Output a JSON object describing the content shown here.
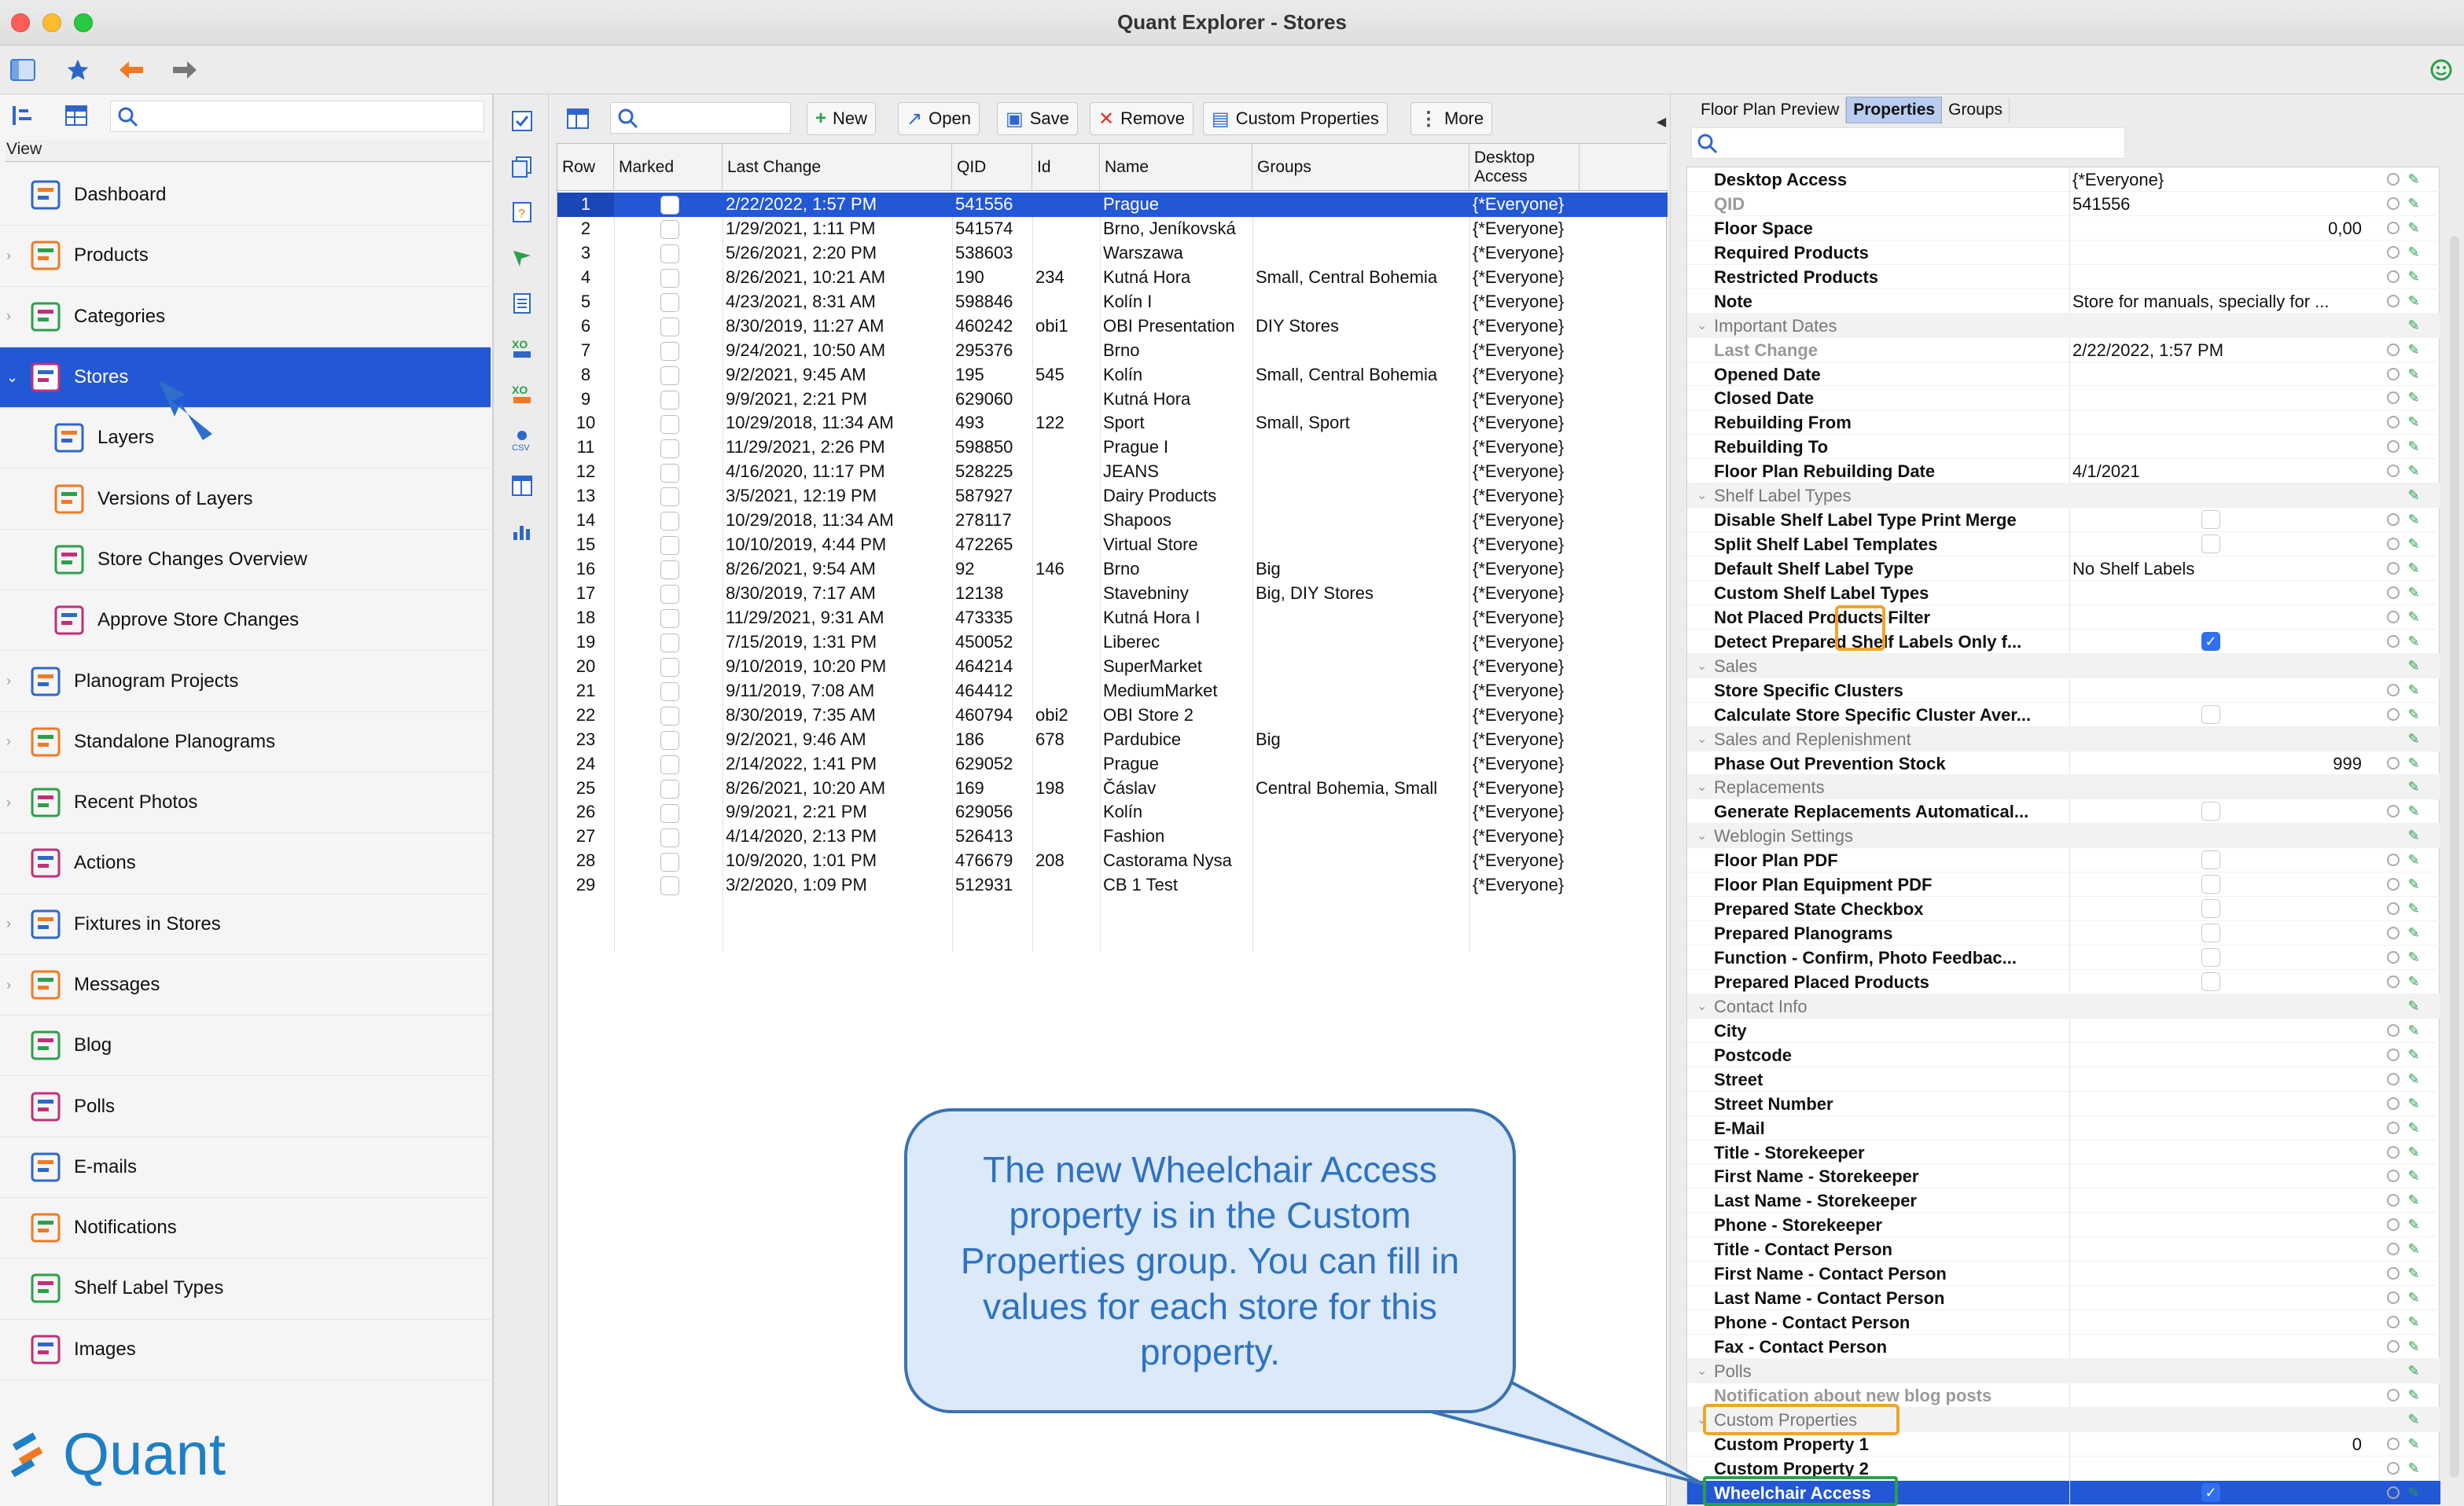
{
  "window": {
    "title": "Quant Explorer - Stores"
  },
  "left": {
    "view_label": "View",
    "nav": [
      {
        "label": "Dashboard",
        "icon": "dashboard-icon",
        "chevron": false,
        "sub": false
      },
      {
        "label": "Products",
        "icon": "products-icon",
        "chevron": true,
        "sub": false
      },
      {
        "label": "Categories",
        "icon": "categories-icon",
        "chevron": true,
        "sub": false
      },
      {
        "label": "Stores",
        "icon": "stores-icon",
        "chevron": true,
        "sub": false,
        "selected": true
      },
      {
        "label": "Layers",
        "icon": "layers-icon",
        "chevron": false,
        "sub": true
      },
      {
        "label": "Versions of Layers",
        "icon": "versions-icon",
        "chevron": false,
        "sub": true
      },
      {
        "label": "Store Changes Overview",
        "icon": "store-changes-icon",
        "chevron": false,
        "sub": true
      },
      {
        "label": "Approve Store Changes",
        "icon": "approve-icon",
        "chevron": false,
        "sub": true
      },
      {
        "label": "Planogram Projects",
        "icon": "planogram-projects-icon",
        "chevron": true,
        "sub": false
      },
      {
        "label": "Standalone Planograms",
        "icon": "standalone-planograms-icon",
        "chevron": true,
        "sub": false
      },
      {
        "label": "Recent Photos",
        "icon": "camera-icon",
        "chevron": true,
        "sub": false
      },
      {
        "label": "Actions",
        "icon": "actions-icon",
        "chevron": false,
        "sub": false
      },
      {
        "label": "Fixtures in Stores",
        "icon": "fixtures-icon",
        "chevron": true,
        "sub": false
      },
      {
        "label": "Messages",
        "icon": "messages-icon",
        "chevron": true,
        "sub": false
      },
      {
        "label": "Blog",
        "icon": "blog-icon",
        "chevron": false,
        "sub": false
      },
      {
        "label": "Polls",
        "icon": "polls-icon",
        "chevron": false,
        "sub": false
      },
      {
        "label": "E-mails",
        "icon": "email-icon",
        "chevron": false,
        "sub": false
      },
      {
        "label": "Notifications",
        "icon": "notifications-icon",
        "chevron": false,
        "sub": false
      },
      {
        "label": "Shelf Label Types",
        "icon": "shelf-label-icon",
        "chevron": false,
        "sub": false
      },
      {
        "label": "Images",
        "icon": "images-icon",
        "chevron": false,
        "sub": false
      }
    ],
    "logo_text": "Quant"
  },
  "toolbar": {
    "new_label": "New",
    "open_label": "Open",
    "save_label": "Save",
    "remove_label": "Remove",
    "custom_properties_label": "Custom Properties",
    "more_label": "More"
  },
  "table": {
    "columns": [
      "Row",
      "Marked",
      "Last Change",
      "QID",
      "Id",
      "Name",
      "Groups",
      "Desktop Access"
    ],
    "rows": [
      [
        "1",
        "",
        "2/22/2022, 1:57 PM",
        "541556",
        "",
        "Prague",
        "",
        "{*Everyone}"
      ],
      [
        "2",
        "",
        "1/29/2021, 1:11 PM",
        "541574",
        "",
        "Brno, Jeníkovská",
        "",
        "{*Everyone}"
      ],
      [
        "3",
        "",
        "5/26/2021, 2:20 PM",
        "538603",
        "",
        "Warszawa",
        "",
        "{*Everyone}"
      ],
      [
        "4",
        "",
        "8/26/2021, 10:21 AM",
        "190",
        "234",
        "Kutná Hora",
        "Small, Central Bohemia",
        "{*Everyone}"
      ],
      [
        "5",
        "",
        "4/23/2021, 8:31 AM",
        "598846",
        "",
        "Kolín I",
        "",
        "{*Everyone}"
      ],
      [
        "6",
        "",
        "8/30/2019, 11:27 AM",
        "460242",
        "obi1",
        "OBI Presentation",
        "DIY Stores",
        "{*Everyone}"
      ],
      [
        "7",
        "",
        "9/24/2021, 10:50 AM",
        "295376",
        "",
        "Brno",
        "",
        "{*Everyone}"
      ],
      [
        "8",
        "",
        "9/2/2021, 9:45 AM",
        "195",
        "545",
        "Kolín",
        "Small, Central Bohemia",
        "{*Everyone}"
      ],
      [
        "9",
        "",
        "9/9/2021, 2:21 PM",
        "629060",
        "",
        "Kutná Hora",
        "",
        "{*Everyone}"
      ],
      [
        "10",
        "",
        "10/29/2018, 11:34 AM",
        "493",
        "122",
        "Sport",
        "Small, Sport",
        "{*Everyone}"
      ],
      [
        "11",
        "",
        "11/29/2021, 2:26 PM",
        "598850",
        "",
        "Prague I",
        "",
        "{*Everyone}"
      ],
      [
        "12",
        "",
        "4/16/2020, 11:17 PM",
        "528225",
        "",
        "JEANS",
        "",
        "{*Everyone}"
      ],
      [
        "13",
        "",
        "3/5/2021, 12:19 PM",
        "587927",
        "",
        "Dairy Products",
        "",
        "{*Everyone}"
      ],
      [
        "14",
        "",
        "10/29/2018, 11:34 AM",
        "278117",
        "",
        "Shapoos",
        "",
        "{*Everyone}"
      ],
      [
        "15",
        "",
        "10/10/2019, 4:44 PM",
        "472265",
        "",
        "Virtual Store",
        "",
        "{*Everyone}"
      ],
      [
        "16",
        "",
        "8/26/2021, 9:54 AM",
        "92",
        "146",
        "Brno",
        "Big",
        "{*Everyone}"
      ],
      [
        "17",
        "",
        "8/30/2019, 7:17 AM",
        "12138",
        "",
        "Stavebniny",
        "Big, DIY Stores",
        "{*Everyone}"
      ],
      [
        "18",
        "",
        "11/29/2021, 9:31 AM",
        "473335",
        "",
        "Kutná Hora I",
        "",
        "{*Everyone}"
      ],
      [
        "19",
        "",
        "7/15/2019, 1:31 PM",
        "450052",
        "",
        "Liberec",
        "",
        "{*Everyone}"
      ],
      [
        "20",
        "",
        "9/10/2019, 10:20 PM",
        "464214",
        "",
        "SuperMarket",
        "",
        "{*Everyone}"
      ],
      [
        "21",
        "",
        "9/11/2019, 7:08 AM",
        "464412",
        "",
        "MediumMarket",
        "",
        "{*Everyone}"
      ],
      [
        "22",
        "",
        "8/30/2019, 7:35 AM",
        "460794",
        "obi2",
        "OBI Store 2",
        "",
        "{*Everyone}"
      ],
      [
        "23",
        "",
        "9/2/2021, 9:46 AM",
        "186",
        "678",
        "Pardubice",
        "Big",
        "{*Everyone}"
      ],
      [
        "24",
        "",
        "2/14/2022, 1:41 PM",
        "629052",
        "",
        "Prague",
        "",
        "{*Everyone}"
      ],
      [
        "25",
        "",
        "8/26/2021, 10:20 AM",
        "169",
        "198",
        "Čáslav",
        "Central Bohemia, Small",
        "{*Everyone}"
      ],
      [
        "26",
        "",
        "9/9/2021, 2:21 PM",
        "629056",
        "",
        "Kolín",
        "",
        "{*Everyone}"
      ],
      [
        "27",
        "",
        "4/14/2020, 2:13 PM",
        "526413",
        "",
        "Fashion",
        "",
        "{*Everyone}"
      ],
      [
        "28",
        "",
        "10/9/2020, 1:01 PM",
        "476679",
        "208",
        "Castorama Nysa",
        "",
        "{*Everyone}"
      ],
      [
        "29",
        "",
        "3/2/2020, 1:09 PM",
        "512931",
        "",
        "CB 1 Test",
        "",
        "{*Everyone}"
      ]
    ]
  },
  "right": {
    "tabs": [
      "Floor Plan Preview",
      "Properties",
      "Groups"
    ],
    "active_tab": "Properties",
    "properties": [
      {
        "name": "Desktop Access",
        "kind": "text",
        "value": "{*Everyone}"
      },
      {
        "name": "QID",
        "kind": "text",
        "value": "541556",
        "muted": true
      },
      {
        "name": "Floor Space",
        "kind": "num",
        "value": "0,00"
      },
      {
        "name": "Required Products",
        "kind": "text",
        "value": ""
      },
      {
        "name": "Restricted Products",
        "kind": "text",
        "value": ""
      },
      {
        "name": "Note",
        "kind": "text",
        "value": "Store for manuals, specially for ..."
      },
      {
        "name": "Important Dates",
        "kind": "group"
      },
      {
        "name": "Last Change",
        "kind": "text",
        "value": "2/22/2022, 1:57 PM",
        "muted": true
      },
      {
        "name": "Opened Date",
        "kind": "text",
        "value": ""
      },
      {
        "name": "Closed Date",
        "kind": "text",
        "value": ""
      },
      {
        "name": "Rebuilding From",
        "kind": "text",
        "value": ""
      },
      {
        "name": "Rebuilding To",
        "kind": "text",
        "value": ""
      },
      {
        "name": "Floor Plan Rebuilding Date",
        "kind": "text",
        "value": "4/1/2021"
      },
      {
        "name": "Shelf Label Types",
        "kind": "group"
      },
      {
        "name": "Disable Shelf Label Type Print Merge",
        "kind": "check",
        "checked": false
      },
      {
        "name": "Split Shelf Label Templates",
        "kind": "check",
        "checked": false
      },
      {
        "name": "Default Shelf Label Type",
        "kind": "text",
        "value": "No Shelf Labels"
      },
      {
        "name": "Custom Shelf Label Types",
        "kind": "text",
        "value": ""
      },
      {
        "name": "Not Placed Products Filter",
        "kind": "text",
        "value": ""
      },
      {
        "name": "Detect Prepared Shelf Labels Only f...",
        "kind": "check",
        "checked": true
      },
      {
        "name": "Sales",
        "kind": "group"
      },
      {
        "name": "Store Specific Clusters",
        "kind": "text",
        "value": ""
      },
      {
        "name": "Calculate Store Specific Cluster Aver...",
        "kind": "check",
        "checked": false
      },
      {
        "name": "Sales and Replenishment",
        "kind": "group"
      },
      {
        "name": "Phase Out Prevention Stock",
        "kind": "num",
        "value": "999"
      },
      {
        "name": "Replacements",
        "kind": "group"
      },
      {
        "name": "Generate Replacements Automatical...",
        "kind": "check",
        "checked": false
      },
      {
        "name": "Weblogin Settings",
        "kind": "group"
      },
      {
        "name": "Floor Plan PDF",
        "kind": "check",
        "checked": false
      },
      {
        "name": "Floor Plan Equipment PDF",
        "kind": "check",
        "checked": false
      },
      {
        "name": "Prepared State Checkbox",
        "kind": "check",
        "checked": false
      },
      {
        "name": "Prepared Planograms",
        "kind": "check",
        "checked": false
      },
      {
        "name": "Function - Confirm, Photo Feedbac...",
        "kind": "check",
        "checked": false
      },
      {
        "name": "Prepared Placed Products",
        "kind": "check",
        "checked": false
      },
      {
        "name": "Contact Info",
        "kind": "group"
      },
      {
        "name": "City",
        "kind": "text",
        "value": ""
      },
      {
        "name": "Postcode",
        "kind": "text",
        "value": ""
      },
      {
        "name": "Street",
        "kind": "text",
        "value": ""
      },
      {
        "name": "Street Number",
        "kind": "text",
        "value": ""
      },
      {
        "name": "E-Mail",
        "kind": "text",
        "value": ""
      },
      {
        "name": "Title - Storekeeper",
        "kind": "text",
        "value": ""
      },
      {
        "name": "First Name - Storekeeper",
        "kind": "text",
        "value": ""
      },
      {
        "name": "Last Name - Storekeeper",
        "kind": "text",
        "value": ""
      },
      {
        "name": "Phone - Storekeeper",
        "kind": "text",
        "value": ""
      },
      {
        "name": "Title - Contact Person",
        "kind": "text",
        "value": ""
      },
      {
        "name": "First Name - Contact Person",
        "kind": "text",
        "value": ""
      },
      {
        "name": "Last Name - Contact Person",
        "kind": "text",
        "value": ""
      },
      {
        "name": "Phone - Contact Person",
        "kind": "text",
        "value": ""
      },
      {
        "name": "Fax - Contact Person",
        "kind": "text",
        "value": ""
      },
      {
        "name": "Polls",
        "kind": "group"
      },
      {
        "name": "Notification about new blog posts",
        "kind": "text",
        "value": "",
        "muted": true
      },
      {
        "name": "Custom Properties",
        "kind": "group"
      },
      {
        "name": "Custom Property 1",
        "kind": "num",
        "value": "0"
      },
      {
        "name": "Custom Property 2",
        "kind": "text",
        "value": ""
      },
      {
        "name": "Wheelchair Access",
        "kind": "check",
        "checked": true,
        "selected": true
      }
    ]
  },
  "callout": {
    "text": "The new Wheelchair Access property is in the Custom Properties group. You can fill in values for each store for this property."
  },
  "colors": {
    "selection": "#2257d6",
    "callout_border": "#3a72b3",
    "callout_text": "#2e72c2",
    "highlight_orange": "#f1a42a",
    "highlight_green": "#2aa04a",
    "brand": "#1f7fc6"
  }
}
